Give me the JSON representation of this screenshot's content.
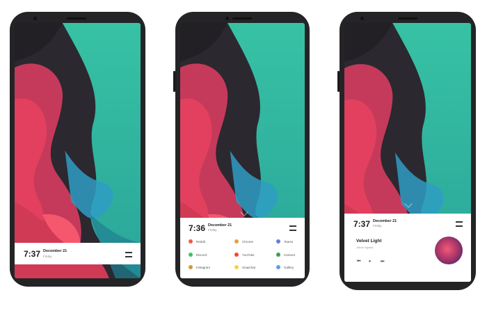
{
  "phones": [
    {
      "lock": {
        "time": "7:37",
        "date": "December 21",
        "day": "Friday"
      }
    },
    {
      "lock": {
        "time": "7:36",
        "date": "December 21",
        "day": "Friday"
      },
      "apps": [
        {
          "label": "Reddit",
          "color": "#f05a4a",
          "icon": "reddit-icon"
        },
        {
          "label": "Chrome",
          "color": "#e5a23a",
          "icon": "chrome-icon"
        },
        {
          "label": "Teams",
          "color": "#6b7bd6",
          "icon": "teams-icon"
        },
        {
          "label": "Discord",
          "color": "#3ec16b",
          "icon": "discord-icon"
        },
        {
          "label": "YouTube",
          "color": "#f04a3a",
          "icon": "youtube-icon"
        },
        {
          "label": "Camera",
          "color": "#3e9e5a",
          "icon": "camera-icon"
        },
        {
          "label": "Instagram",
          "color": "#d19a3a",
          "icon": "instagram-icon"
        },
        {
          "label": "Snapchat",
          "color": "#f3d63a",
          "icon": "snapchat-icon"
        },
        {
          "label": "Gallery",
          "color": "#5aa0e6",
          "icon": "gallery-icon"
        }
      ]
    },
    {
      "lock": {
        "time": "7:37",
        "date": "December 21",
        "day": "Friday"
      },
      "music": {
        "title": "Velvet Light",
        "artist": "Jakob Ogawa"
      }
    }
  ],
  "icons": {
    "prev": "⏮",
    "pause": "⏸",
    "next": "⏭"
  }
}
